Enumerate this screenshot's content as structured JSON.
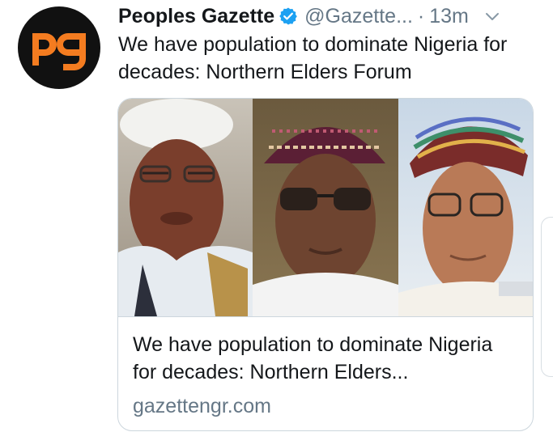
{
  "tweet": {
    "avatar": {
      "logo_text": "pg",
      "colors": {
        "background": "#111111",
        "letters": "#f47c20"
      }
    },
    "display_name": "Peoples Gazette",
    "verified_icon": "verified-badge-icon",
    "handle": "@Gazette...",
    "separator": "·",
    "time": "13m",
    "caret_icon": "chevron-down-icon",
    "text": "We have population to dominate Nigeria for decades: Northern Elders Forum",
    "card": {
      "image_icon": "photo-of-three-men",
      "title": "We have population to dominate Nigeria for decades: Northern Elders...",
      "domain": "gazettengr.com"
    }
  },
  "colors": {
    "primary_text": "#14171a",
    "secondary_text": "#657786",
    "verified_blue": "#1da1f2",
    "border": "#ccd6dd"
  }
}
